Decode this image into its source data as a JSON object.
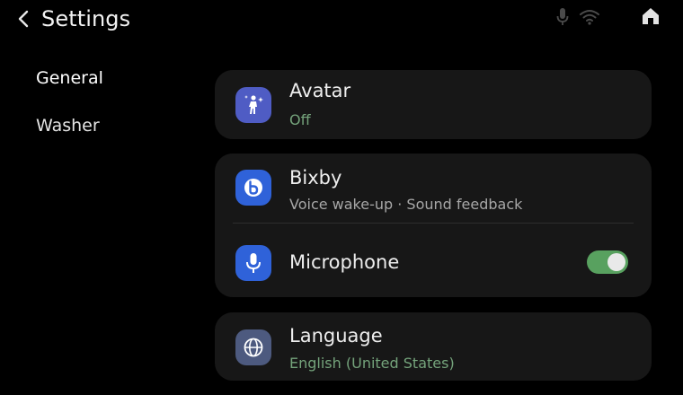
{
  "header": {
    "title": "Settings",
    "back_icon": "chevron-left-icon",
    "status_icons": [
      "microphone-icon",
      "wifi-icon"
    ],
    "home_icon": "home-icon"
  },
  "sidebar": {
    "items": [
      {
        "label": "General",
        "selected": true
      },
      {
        "label": "Washer",
        "selected": false
      }
    ]
  },
  "settings": {
    "avatar": {
      "title": "Avatar",
      "subtitle": "Off",
      "icon": "person-sparkle-icon"
    },
    "bixby": {
      "title": "Bixby",
      "subtitle": "Voice wake-up · Sound feedback",
      "icon": "bixby-icon"
    },
    "microphone": {
      "title": "Microphone",
      "enabled": true,
      "icon": "microphone-icon"
    },
    "language": {
      "title": "Language",
      "subtitle": "English (United States)",
      "icon": "globe-icon"
    }
  },
  "colors": {
    "background": "#000000",
    "card": "#171717",
    "accent_green": "#58a15f",
    "subtitle_green": "#74a37b",
    "icon_blue": "#2f62d9",
    "icon_purple": "#4f5cc4",
    "icon_slate": "#4d5a7f"
  }
}
